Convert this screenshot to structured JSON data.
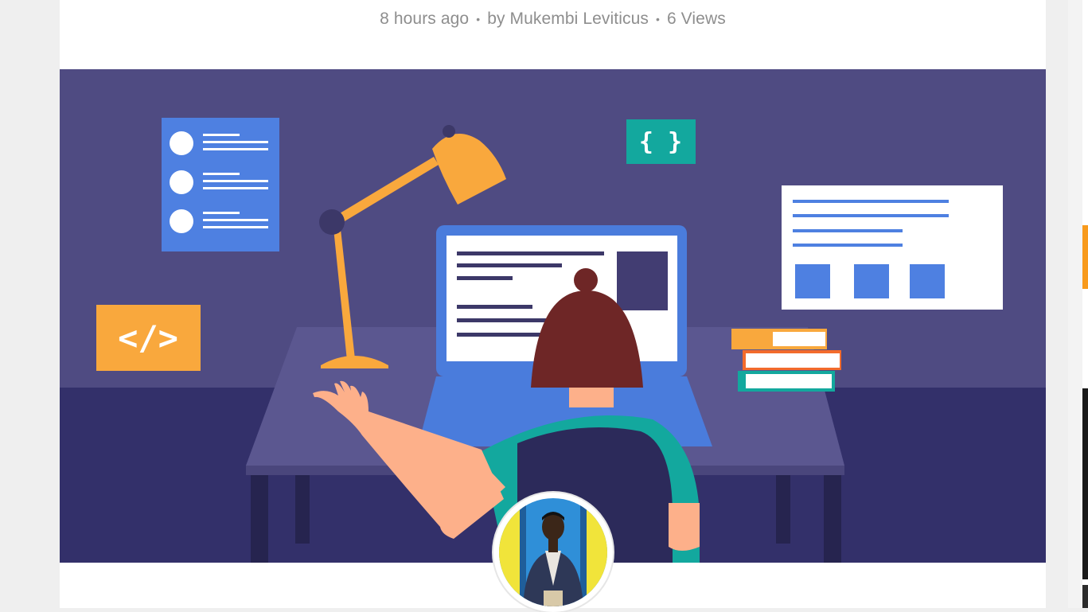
{
  "post_meta": {
    "time": "8 hours ago",
    "author": "by Mukembi Leviticus",
    "views": "6 Views",
    "separator": "•"
  },
  "hero": {
    "code_tag": "</>",
    "braces": "{ }",
    "colors": {
      "background": "#4f4b82",
      "floor": "#33306a",
      "desk": "#5b5790",
      "lamp": "#f9a83d",
      "laptop": "#4a7cdc",
      "hair": "#6e2626",
      "shirt": "#13a89e",
      "skin": "#fdb08a"
    }
  },
  "author_avatar": {
    "alt": "Mukembi Leviticus"
  }
}
